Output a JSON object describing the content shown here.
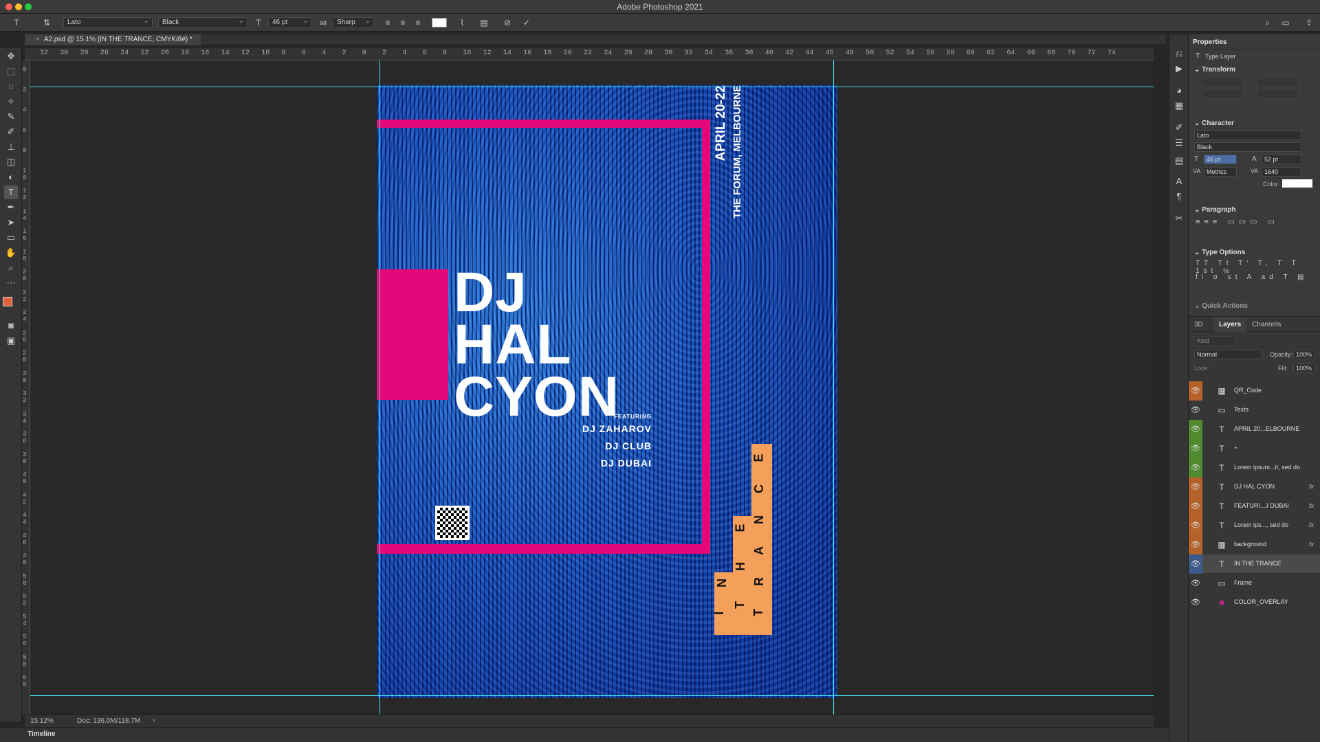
{
  "app": {
    "title": "Adobe Photoshop 2021"
  },
  "options_bar": {
    "font_family": "Lato",
    "font_style": "Black",
    "font_size": "46 pt",
    "antialias": "Sharp"
  },
  "document": {
    "tab_label": "A2.psd @ 15.1% (IN THE TRANCE, CMYK/8#) *"
  },
  "ruler_top": [
    "32",
    "30",
    "28",
    "26",
    "24",
    "22",
    "20",
    "18",
    "16",
    "14",
    "12",
    "10",
    "8",
    "6",
    "4",
    "2",
    "0",
    "2",
    "4",
    "6",
    "8",
    "10",
    "12",
    "14",
    "16",
    "18",
    "20",
    "22",
    "24",
    "26",
    "28",
    "30",
    "32",
    "34",
    "36",
    "38",
    "40",
    "42",
    "44",
    "46",
    "48",
    "50",
    "52",
    "54",
    "56",
    "58",
    "60",
    "62",
    "64",
    "66",
    "68",
    "70",
    "72",
    "74"
  ],
  "ruler_left": [
    "0",
    "2",
    "4",
    "6",
    "8",
    "1 0",
    "1 2",
    "1 4",
    "1 6",
    "1 8",
    "2 0",
    "2 2",
    "2 4",
    "2 6",
    "2 8",
    "3 0",
    "3 2",
    "3 4",
    "3 6",
    "3 8",
    "4 0",
    "4 2",
    "4 4",
    "4 6",
    "4 8",
    "5 0",
    "5 2",
    "5 4",
    "5 6",
    "5 8",
    "6 0"
  ],
  "poster": {
    "date": "APRIL 20-22",
    "venue": "THE FORUM, MELBOURNE",
    "headline": [
      "DJ",
      "HAL",
      "CYON"
    ],
    "featuring": "FEATURING",
    "guests": [
      "DJ ZAHAROV",
      "DJ CLUB",
      "DJ DUBAI"
    ],
    "trance_letters": [
      "I",
      "N",
      "T",
      "H",
      "E",
      "T",
      "R",
      "A",
      "N",
      "C",
      "E"
    ],
    "colors": {
      "pink": "#e4077a",
      "blue": "#1a5bc8",
      "orange": "#f4a05a"
    }
  },
  "status": {
    "zoom": "15.12%",
    "doc": "Doc: 136.0M/118.7M"
  },
  "timeline": {
    "label": "Timeline"
  },
  "properties": {
    "title": "Properties",
    "layer_type": "Type Layer",
    "transform_label": "Transform",
    "character_label": "Character",
    "font": "Lato",
    "style": "Black",
    "size": "46 pt",
    "leading": "52 pt",
    "kerning": "Metrics",
    "tracking": "1640",
    "color_label": "Color",
    "paragraph_label": "Paragraph",
    "type_options_label": "Type Options",
    "quick_actions_label": "Quick Actions"
  },
  "layers_panel": {
    "tabs": [
      "3D",
      "Layers",
      "Channels"
    ],
    "blend_mode": "Normal",
    "opacity_label": "Opacity:",
    "opacity": "100%",
    "lock_label": "Lock:",
    "fill_label": "Fill:",
    "fill": "100%",
    "kind_placeholder": "Kind",
    "layers": [
      {
        "name": "QR_Code",
        "icon": "image-icon",
        "eye_color": "#b4622a",
        "fx": ""
      },
      {
        "name": "Texts",
        "icon": "folder-icon",
        "eye_color": "",
        "fx": ""
      },
      {
        "name": "APRIL 20...ELBOURNE",
        "icon": "type-icon",
        "eye_color": "#4f8a2e",
        "fx": ""
      },
      {
        "name": "+",
        "icon": "type-icon",
        "eye_color": "#4f8a2e",
        "fx": ""
      },
      {
        "name": "Lorem ipsum...it, sed do",
        "icon": "type-icon",
        "eye_color": "#4f8a2e",
        "fx": ""
      },
      {
        "name": "DJ HAL CYON",
        "icon": "type-icon",
        "eye_color": "#b4622a",
        "fx": "fx"
      },
      {
        "name": "FEATURI...J DUBAI",
        "icon": "type-icon",
        "eye_color": "#b4622a",
        "fx": "fx"
      },
      {
        "name": "Lorem ips..., sed do",
        "icon": "type-icon",
        "eye_color": "#b4622a",
        "fx": "fx"
      },
      {
        "name": "background",
        "icon": "image-icon",
        "eye_color": "#b4622a",
        "fx": "fx"
      },
      {
        "name": "IN THE TRANCE",
        "icon": "type-icon",
        "eye_color": "#3c5a8c",
        "fx": ""
      },
      {
        "name": "Frame",
        "icon": "folder-icon",
        "eye_color": "",
        "fx": ""
      },
      {
        "name": "COLOR_OVERLAY",
        "icon": "color-fill-icon",
        "eye_color": "",
        "fx": ""
      }
    ]
  }
}
